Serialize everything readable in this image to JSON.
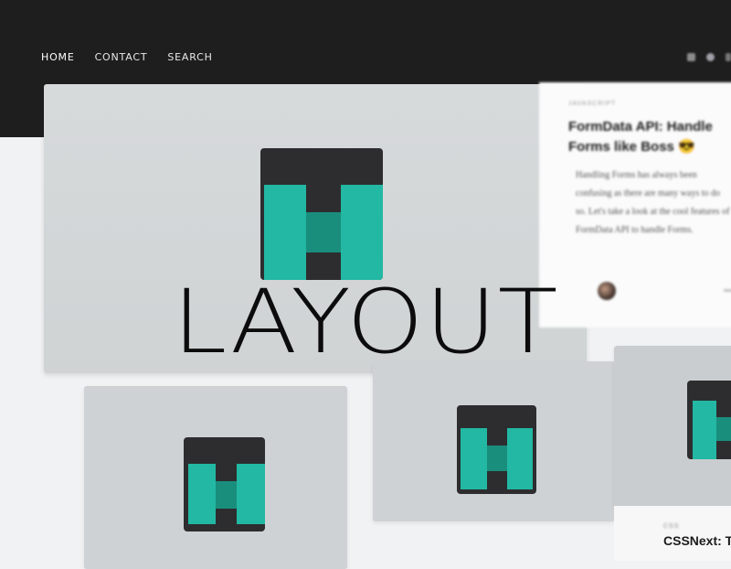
{
  "nav": {
    "items": [
      "HOME",
      "CONTACT",
      "SEARCH"
    ],
    "active": "HOME"
  },
  "header_icons": [
    "mail-icon",
    "avatar-icon",
    "menu-icon"
  ],
  "featured": {
    "category": "JAVASCRIPT",
    "title": "FormData API: Handle Forms like Boss 😎",
    "excerpt": "Handling Forms has always been confusing as there are many ways to do so. Let's take a look at the cool features of FormData API to handle Forms."
  },
  "cards": [
    {
      "category": "",
      "title": ""
    },
    {
      "category": "",
      "title": ""
    },
    {
      "category": "CSS",
      "title": "CSSNext: T"
    }
  ],
  "overlay": {
    "word": "LAYOUT"
  },
  "colors": {
    "header_bg": "#1e1e1f",
    "logo_dark": "#2d2d2f",
    "logo_teal": "#22b8a3",
    "logo_teal_dark": "#1a8e7d"
  }
}
